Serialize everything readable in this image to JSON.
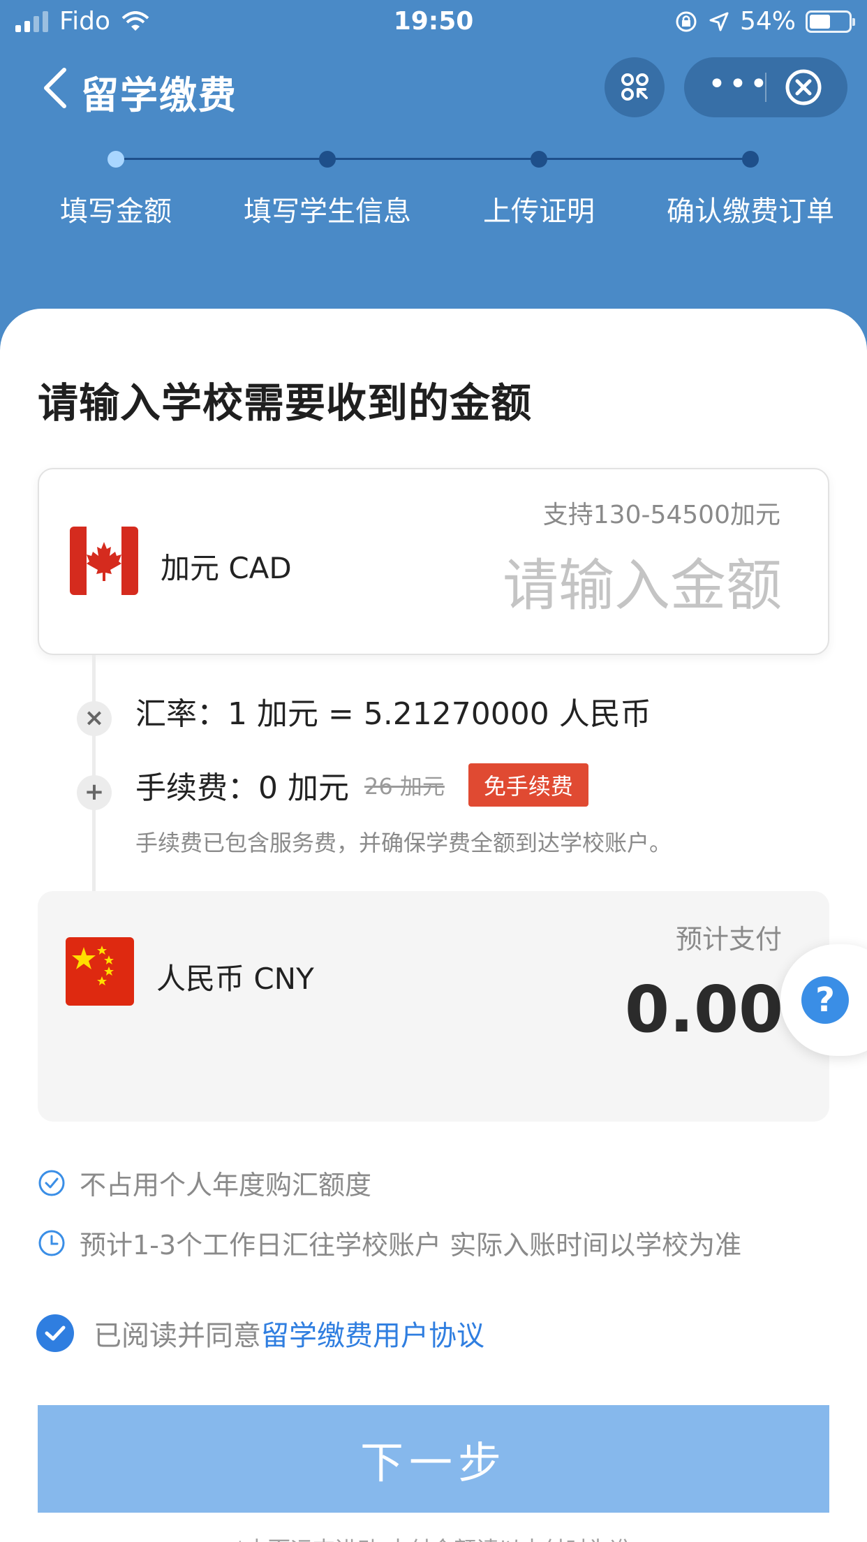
{
  "status_bar": {
    "carrier": "Fido",
    "time": "19:50",
    "battery_percent": "54%",
    "battery_level": 0.54
  },
  "navbar": {
    "title": "留学缴费",
    "more_label": "•••"
  },
  "steps": {
    "items": [
      "填写金额",
      "填写学生信息",
      "上传证明",
      "确认缴费订单"
    ],
    "active_index": 0
  },
  "form": {
    "title": "请输入学校需要收到的金额",
    "source_currency": {
      "name": "加元 CAD",
      "range_hint": "支持130-54500加元",
      "amount_placeholder": "请输入金额",
      "amount_value": ""
    },
    "exchange_rate": "汇率：1 加元 = 5.21270000 人民币",
    "fee": {
      "label": "手续费：0 加元",
      "original": "26 加元",
      "badge": "免手续费",
      "note": "手续费已包含服务费，并确保学费全额到达学校账户。"
    },
    "target_currency": {
      "name": "人民币 CNY",
      "estimate_label": "预计支付",
      "estimate_value": "0.00"
    }
  },
  "features": [
    "不占用个人年度购汇额度",
    "预计1-3个工作日汇往学校账户 实际入账时间以学校为准"
  ],
  "agreement": {
    "prefix": "已阅读并同意",
    "link": "留学缴费用户协议",
    "checked": true
  },
  "next_button": "下一步",
  "bottom_note": "*丰而运吉进动 支付金额请以支付时为准",
  "icons": {
    "back": "chevron-left-icon",
    "scan": "scan-icon",
    "close": "close-circle-icon",
    "help": "question-icon",
    "check_circle": "check-circle-icon",
    "clock": "clock-icon"
  },
  "colors": {
    "header_bg": "#4a8ac7",
    "accent": "#2f7ee0",
    "badge": "#e04a32",
    "button": "#86b8ec"
  }
}
